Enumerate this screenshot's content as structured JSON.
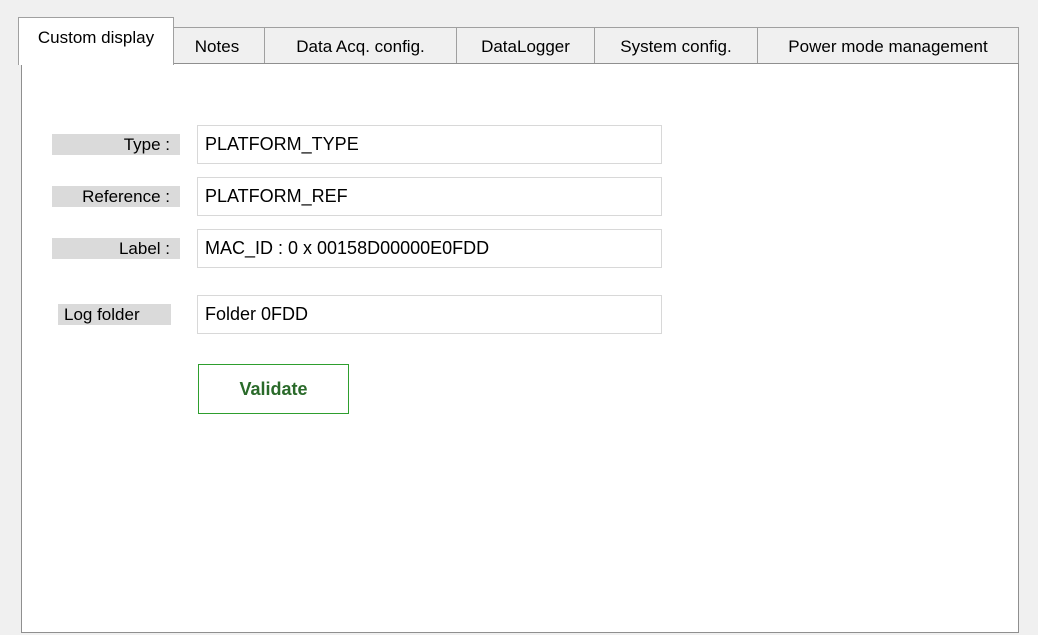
{
  "tabs": [
    {
      "label": "Custom display",
      "active": true
    },
    {
      "label": "Notes",
      "active": false
    },
    {
      "label": "Data Acq. config.",
      "active": false
    },
    {
      "label": "DataLogger",
      "active": false
    },
    {
      "label": "System config.",
      "active": false
    },
    {
      "label": "Power mode management",
      "active": false
    }
  ],
  "form": {
    "type": {
      "label": "Type :",
      "value": "PLATFORM_TYPE"
    },
    "reference": {
      "label": "Reference :",
      "value": "PLATFORM_REF"
    },
    "label": {
      "label": "Label :",
      "value": "MAC_ID : 0 x 00158D00000E0FDD"
    },
    "log_folder": {
      "label": "Log folder",
      "value": "Folder 0FDD"
    },
    "validate_label": "Validate"
  },
  "colors": {
    "validate_border": "#2e9e2e",
    "validate_text": "#2a6a2a",
    "label_background": "#dadada"
  }
}
